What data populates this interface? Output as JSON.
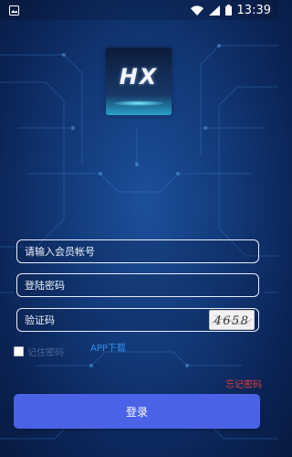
{
  "status_bar": {
    "time": "13:39",
    "icons": [
      "image-icon",
      "wifi-icon",
      "signal-icon",
      "battery-icon"
    ]
  },
  "logo": {
    "text": "HX"
  },
  "form": {
    "account_placeholder": "请输入会员帐号",
    "password_placeholder": "登陆密码",
    "captcha_placeholder": "验证码",
    "captcha_code": "4658",
    "remember_label": "记住密码",
    "remember_checked": false,
    "app_download": "APP下载",
    "forgot_password": "忘记密码",
    "login_button": "登录"
  },
  "colors": {
    "background": "#123a7a",
    "button": "#4a63e6",
    "link_blue": "#2e8ff3",
    "forgot_red": "#e03a3a"
  }
}
